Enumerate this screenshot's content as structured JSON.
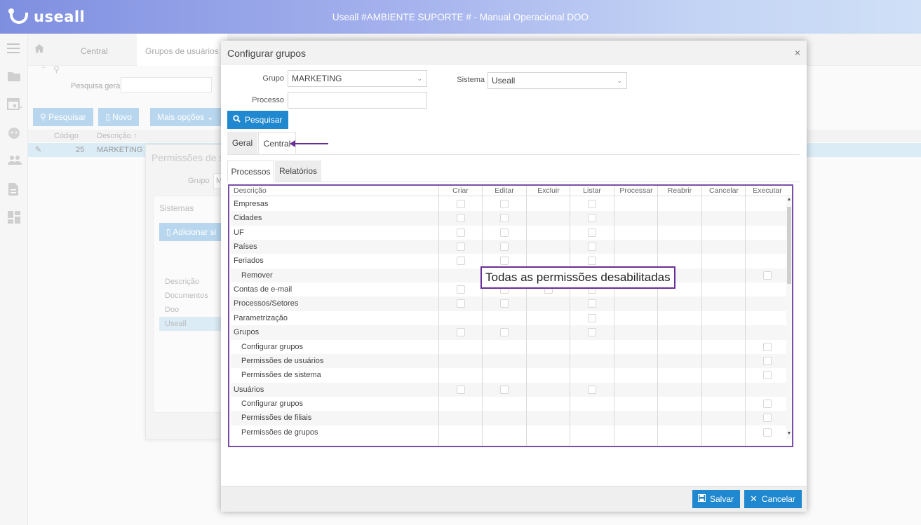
{
  "header": {
    "logo_text": "useall",
    "title": "Useall #AMBIENTE SUPORTE # - Manual Operacional DOO"
  },
  "nav_icons": [
    "menu-icon",
    "folder-icon",
    "calendar-icon",
    "face-icon",
    "people-icon",
    "document-icon",
    "dashboard-icon"
  ],
  "background": {
    "tabs": [
      "Central",
      "Grupos de usuários"
    ],
    "search_label": "Pesquisa geral",
    "buttons": [
      "Pesquisar",
      "Novo",
      "Mais opções"
    ],
    "grid_headers": [
      "Código",
      "Descrição ↑"
    ],
    "grid_row": {
      "code": "25",
      "desc": "MARKETING"
    },
    "perm_title": "Permissões de s",
    "perm_grupo_label": "Grupo",
    "perm_grupo_value": "M",
    "perm_sistemas_label": "Sistemas",
    "perm_add_label": "Adicionar si",
    "perm_list": [
      "Descrição",
      "Documentos",
      "Doo",
      "Useall"
    ]
  },
  "modal": {
    "title": "Configurar grupos",
    "close": "×",
    "grupo_label": "Grupo",
    "grupo_value": "MARKETING",
    "sistema_label": "Sistema",
    "sistema_value": "Useall",
    "processo_label": "Processo",
    "processo_value": "",
    "search_button": "Pesquisar",
    "outer_tabs": [
      "Geral",
      "Central"
    ],
    "inner_tabs": [
      "Processos",
      "Relatórios"
    ],
    "columns": [
      "Descrição",
      "Criar",
      "Editar",
      "Excluir",
      "Listar",
      "Processar",
      "Reabrir",
      "Cancelar",
      "Executar"
    ],
    "rows": [
      {
        "label": "Empresas",
        "sub": false,
        "cb": [
          "Criar",
          "Editar",
          "Listar"
        ]
      },
      {
        "label": "Cidades",
        "sub": false,
        "cb": [
          "Criar",
          "Editar",
          "Listar"
        ]
      },
      {
        "label": "UF",
        "sub": false,
        "cb": [
          "Criar",
          "Editar",
          "Listar"
        ]
      },
      {
        "label": "Países",
        "sub": false,
        "cb": [
          "Criar",
          "Editar",
          "Listar"
        ]
      },
      {
        "label": "Feriados",
        "sub": false,
        "cb": [
          "Criar",
          "Editar",
          "Listar"
        ]
      },
      {
        "label": "Remover",
        "sub": true,
        "cb": [
          "Executar"
        ]
      },
      {
        "label": "Contas de e-mail",
        "sub": false,
        "cb": [
          "Criar",
          "Editar",
          "Excluir",
          "Listar"
        ]
      },
      {
        "label": "Processos/Setores",
        "sub": false,
        "cb": [
          "Criar",
          "Editar",
          "Listar"
        ]
      },
      {
        "label": "Parametrização",
        "sub": false,
        "cb": [
          "Listar"
        ]
      },
      {
        "label": "Grupos",
        "sub": false,
        "cb": [
          "Criar",
          "Editar",
          "Listar"
        ]
      },
      {
        "label": "Configurar grupos",
        "sub": true,
        "cb": [
          "Executar"
        ]
      },
      {
        "label": "Permissões de usuários",
        "sub": true,
        "cb": [
          "Executar"
        ]
      },
      {
        "label": "Permissões de sistema",
        "sub": true,
        "cb": [
          "Executar"
        ]
      },
      {
        "label": "Usuários",
        "sub": false,
        "cb": [
          "Criar",
          "Editar",
          "Listar"
        ]
      },
      {
        "label": "Configurar grupos",
        "sub": true,
        "cb": [
          "Executar"
        ]
      },
      {
        "label": "Permissões de filiais",
        "sub": true,
        "cb": [
          "Executar"
        ]
      },
      {
        "label": "Permissões de grupos",
        "sub": true,
        "cb": [
          "Executar"
        ]
      }
    ],
    "annotation": "Todas as permissões desabilitadas",
    "save_button": "Salvar",
    "cancel_button": "Cancelar"
  },
  "colors": {
    "primary": "#1f88cf",
    "annotation": "#6a2d96",
    "header_start": "#7f8fe0",
    "header_end": "#cfe0f7"
  }
}
